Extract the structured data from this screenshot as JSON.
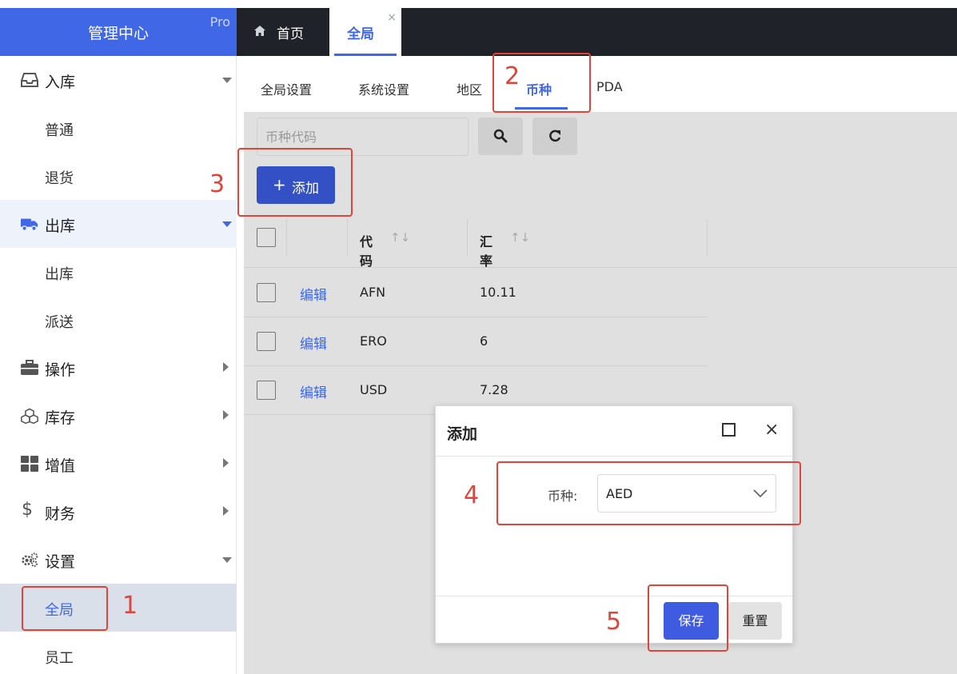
{
  "brand": {
    "title": "管理中心",
    "badge": "Pro"
  },
  "top_tabs": [
    {
      "label": "首页",
      "icon": "home-icon"
    },
    {
      "label": "全局",
      "close": "×"
    }
  ],
  "sidebar": {
    "groups": [
      {
        "label": "入库",
        "icon": "inbox-icon",
        "children": [
          "普通",
          "退货"
        ]
      },
      {
        "label": "出库",
        "icon": "truck-icon",
        "children": [
          "出库",
          "派送"
        ]
      },
      {
        "label": "操作",
        "icon": "briefcase-icon"
      },
      {
        "label": "库存",
        "icon": "cubes-icon"
      },
      {
        "label": "增值",
        "icon": "grid-icon"
      },
      {
        "label": "财务",
        "icon": "dollar-icon",
        "glyph": "$"
      },
      {
        "label": "设置",
        "icon": "gears-icon",
        "children": [
          "全局",
          "员工"
        ]
      }
    ]
  },
  "content_tabs": [
    "全局设置",
    "系统设置",
    "地区",
    "币种",
    "PDA"
  ],
  "search": {
    "placeholder": "币种代码"
  },
  "toolbar": {
    "add_label": "添加",
    "add_icon": "+"
  },
  "table": {
    "headers": {
      "code": "代码",
      "rate": "汇率",
      "sort_glyph": "↑↓"
    },
    "rows": [
      {
        "action": "编辑",
        "code": "AFN",
        "rate": "10.11"
      },
      {
        "action": "编辑",
        "code": "ERO",
        "rate": "6"
      },
      {
        "action": "编辑",
        "code": "USD",
        "rate": "7.28"
      }
    ]
  },
  "dialog": {
    "title": "添加",
    "close": "×",
    "field_label": "币种:",
    "field_value": "AED",
    "save_label": "保存",
    "reset_label": "重置"
  },
  "annotations": [
    "1",
    "2",
    "3",
    "4",
    "5"
  ],
  "colors": {
    "accent": "#3f67e6",
    "annotation": "#e0443a",
    "header_dark": "#20222a"
  }
}
